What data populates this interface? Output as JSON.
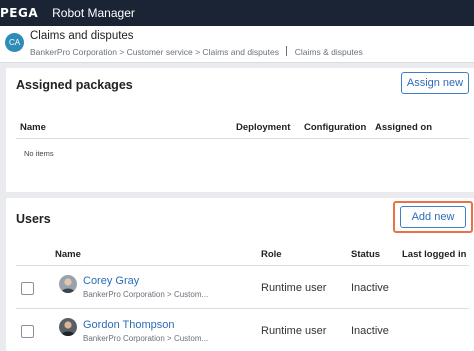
{
  "header": {
    "brand": "PEGA",
    "app_title": "Robot Manager"
  },
  "context": {
    "avatar_initials": "CA",
    "title": "Claims and disputes",
    "breadcrumb": "BankerPro Corporation > Customer service > Claims and disputes",
    "breadcrumb_extra": "Claims & disputes"
  },
  "packages": {
    "title": "Assigned packages",
    "assign_button": "Assign new",
    "columns": [
      "Name",
      "Deployment",
      "Configuration",
      "Assigned on"
    ],
    "empty_text": "No items"
  },
  "users": {
    "title": "Users",
    "add_button": "Add new",
    "columns": [
      "Name",
      "Role",
      "Status",
      "Last logged in"
    ],
    "rows": [
      {
        "name": "Corey Gray",
        "org": "BankerPro Corporation > Custom...",
        "role": "Runtime user",
        "status": "Inactive",
        "last_logged_in": ""
      },
      {
        "name": "Gordon Thompson",
        "org": "BankerPro Corporation > Custom...",
        "role": "Runtime user",
        "status": "Inactive",
        "last_logged_in": ""
      }
    ]
  },
  "colors": {
    "topbar": "#1b2435",
    "accent": "#2b6cb8",
    "highlight": "#e87245",
    "avatar": "#2f8bb7"
  }
}
